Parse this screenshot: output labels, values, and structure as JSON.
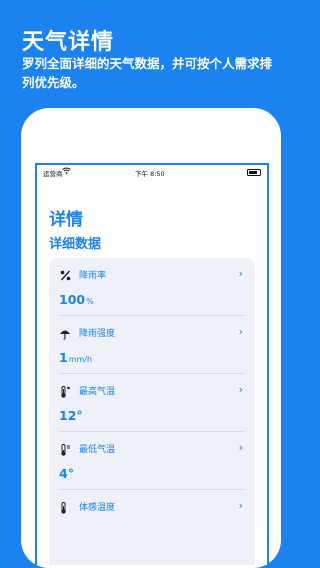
{
  "promo": {
    "title": "天气详情",
    "subtitle": "罗列全面详细的天气数据，并可按个人需求排列优先级。"
  },
  "status_bar": {
    "carrier": "运营商",
    "time": "下午 8:50"
  },
  "page": {
    "title": "详情",
    "subtitle": "详细数据"
  },
  "metrics": [
    {
      "label": "降雨率",
      "value": "100",
      "unit": "%",
      "icon": "percent-icon"
    },
    {
      "label": "降雨强度",
      "value": "1",
      "unit": "mm/h",
      "icon": "umbrella-icon"
    },
    {
      "label": "最高气温",
      "value": "12°",
      "unit": "",
      "icon": "thermometer-high-icon"
    },
    {
      "label": "最低气温",
      "value": "4°",
      "unit": "",
      "icon": "thermometer-low-icon"
    },
    {
      "label": "体感温度",
      "value": "",
      "unit": "",
      "icon": "thermometer-icon"
    }
  ],
  "colors": {
    "accent": "#1b82ef",
    "card": "#eef1f8"
  }
}
